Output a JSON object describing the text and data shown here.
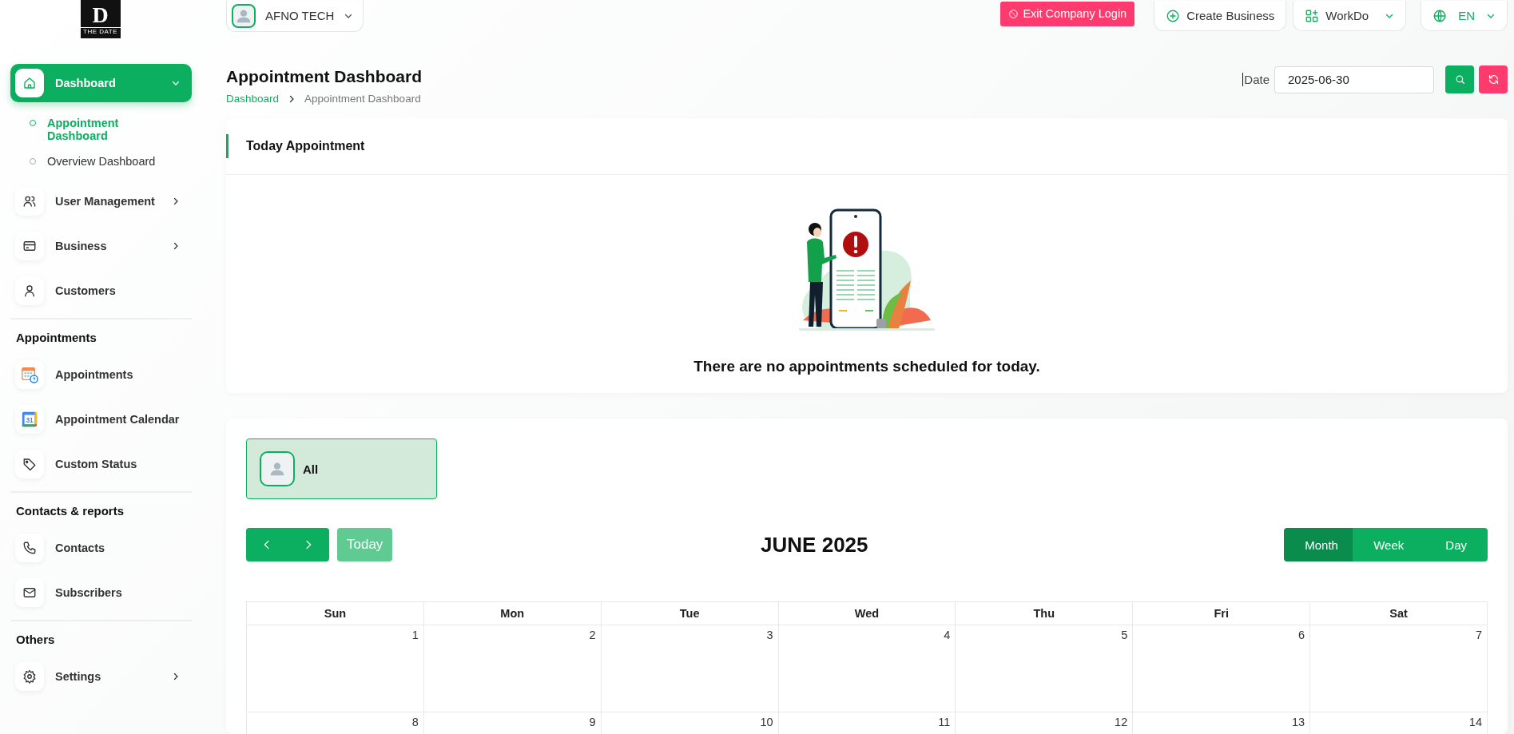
{
  "sidebar": {
    "logo": {
      "letter": "D",
      "caption": "THE DATE"
    },
    "nav": [
      {
        "kind": "group",
        "label": "Dashboard",
        "selected": true,
        "expanded": true,
        "children": [
          {
            "label": "Appointment Dashboard",
            "selected": true
          },
          {
            "label": "Overview Dashboard",
            "selected": false
          }
        ]
      },
      {
        "kind": "group",
        "label": "User Management",
        "selected": false,
        "expanded": false
      },
      {
        "kind": "group",
        "label": "Business",
        "selected": false,
        "expanded": false
      },
      {
        "kind": "link",
        "label": "Customers",
        "selected": false
      },
      {
        "kind": "section",
        "label": "Appointments"
      },
      {
        "kind": "link",
        "label": "Appointments",
        "selected": false
      },
      {
        "kind": "link",
        "label": "Appointment Calendar",
        "selected": false,
        "icon_text": "31"
      },
      {
        "kind": "link",
        "label": "Custom Status",
        "selected": false
      },
      {
        "kind": "section",
        "label": "Contacts & reports"
      },
      {
        "kind": "link",
        "label": "Contacts",
        "selected": false
      },
      {
        "kind": "link",
        "label": "Subscribers",
        "selected": false
      },
      {
        "kind": "section",
        "label": "Others"
      },
      {
        "kind": "group",
        "label": "Settings",
        "selected": false,
        "expanded": false
      }
    ]
  },
  "topbar": {
    "company": "AFNO TECH",
    "exit_button": "Exit Company Login",
    "create_button": "Create Business",
    "workspace": "WorkDo",
    "language": "EN"
  },
  "header": {
    "title": "Appointment Dashboard",
    "breadcrumb": [
      "Dashboard",
      "Appointment Dashboard"
    ],
    "date_label": "Date",
    "date_value": "2025-06-30"
  },
  "today_card": {
    "title": "Today Appointment",
    "empty_message": "There are no appointments scheduled for today."
  },
  "calendar": {
    "filter": {
      "label": "All",
      "selected": true
    },
    "today_button": "Today",
    "title": "JUNE 2025",
    "views": [
      {
        "label": "Month",
        "selected": true
      },
      {
        "label": "Week",
        "selected": false
      },
      {
        "label": "Day",
        "selected": false
      }
    ],
    "weekdays": [
      "Sun",
      "Mon",
      "Tue",
      "Wed",
      "Thu",
      "Fri",
      "Sat"
    ],
    "weeks": [
      [
        "1",
        "2",
        "3",
        "4",
        "5",
        "6",
        "7"
      ],
      [
        "8",
        "9",
        "10",
        "11",
        "12",
        "13",
        "14"
      ]
    ]
  }
}
